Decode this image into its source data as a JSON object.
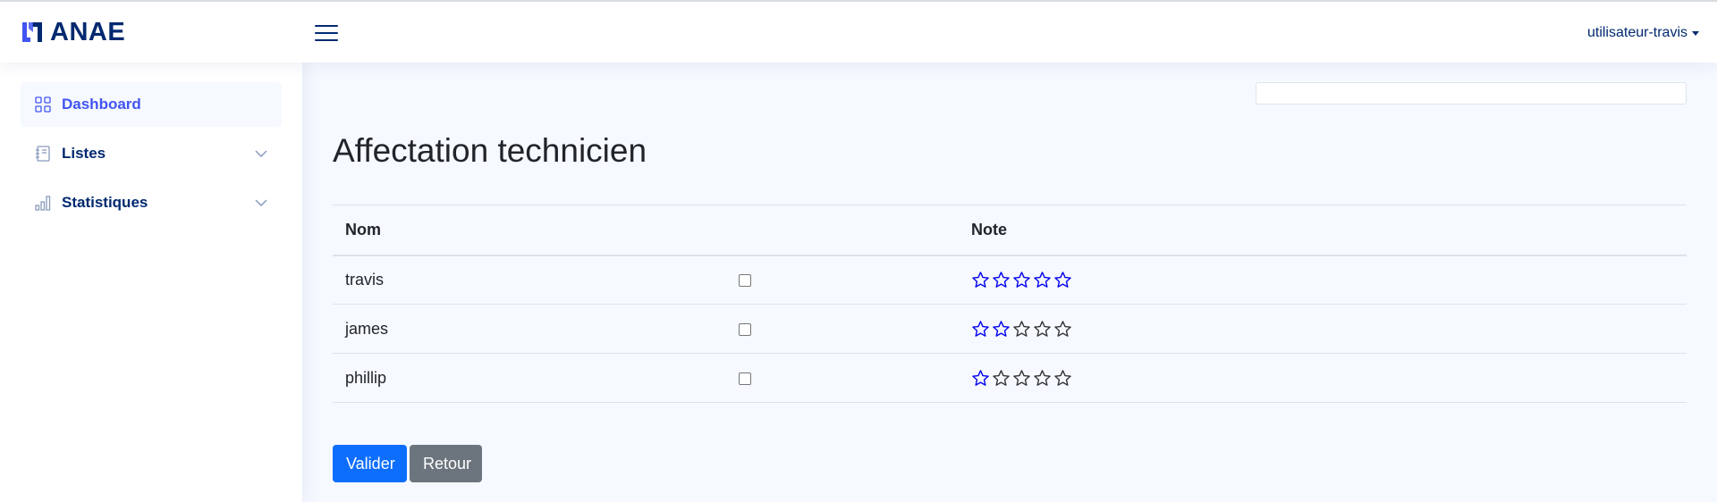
{
  "brand": {
    "name": "ANAE",
    "color": "#012970",
    "accent": "#4154f1"
  },
  "header": {
    "user_label": "utilisateur-travis",
    "menu_icon": "hamburger-icon"
  },
  "sidebar": {
    "items": [
      {
        "label": "Dashboard",
        "icon": "grid-icon",
        "active": true
      },
      {
        "label": "Listes",
        "icon": "journal-icon",
        "active": false,
        "expandable": true
      },
      {
        "label": "Statistiques",
        "icon": "bar-chart-icon",
        "active": false,
        "expandable": true
      }
    ]
  },
  "search": {
    "value": "",
    "placeholder": ""
  },
  "page": {
    "title": "Affectation technicien"
  },
  "table": {
    "headers": {
      "nom": "Nom",
      "check": "",
      "note": "Note"
    },
    "rows": [
      {
        "nom": "travis",
        "checked": false,
        "rating": 5
      },
      {
        "nom": "james",
        "checked": false,
        "rating": 2
      },
      {
        "nom": "phillip",
        "checked": false,
        "rating": 1
      }
    ],
    "max_rating": 5,
    "star_color_filled": "#0000ee",
    "star_color_empty": "#333333"
  },
  "actions": {
    "submit_label": "Valider",
    "back_label": "Retour"
  }
}
